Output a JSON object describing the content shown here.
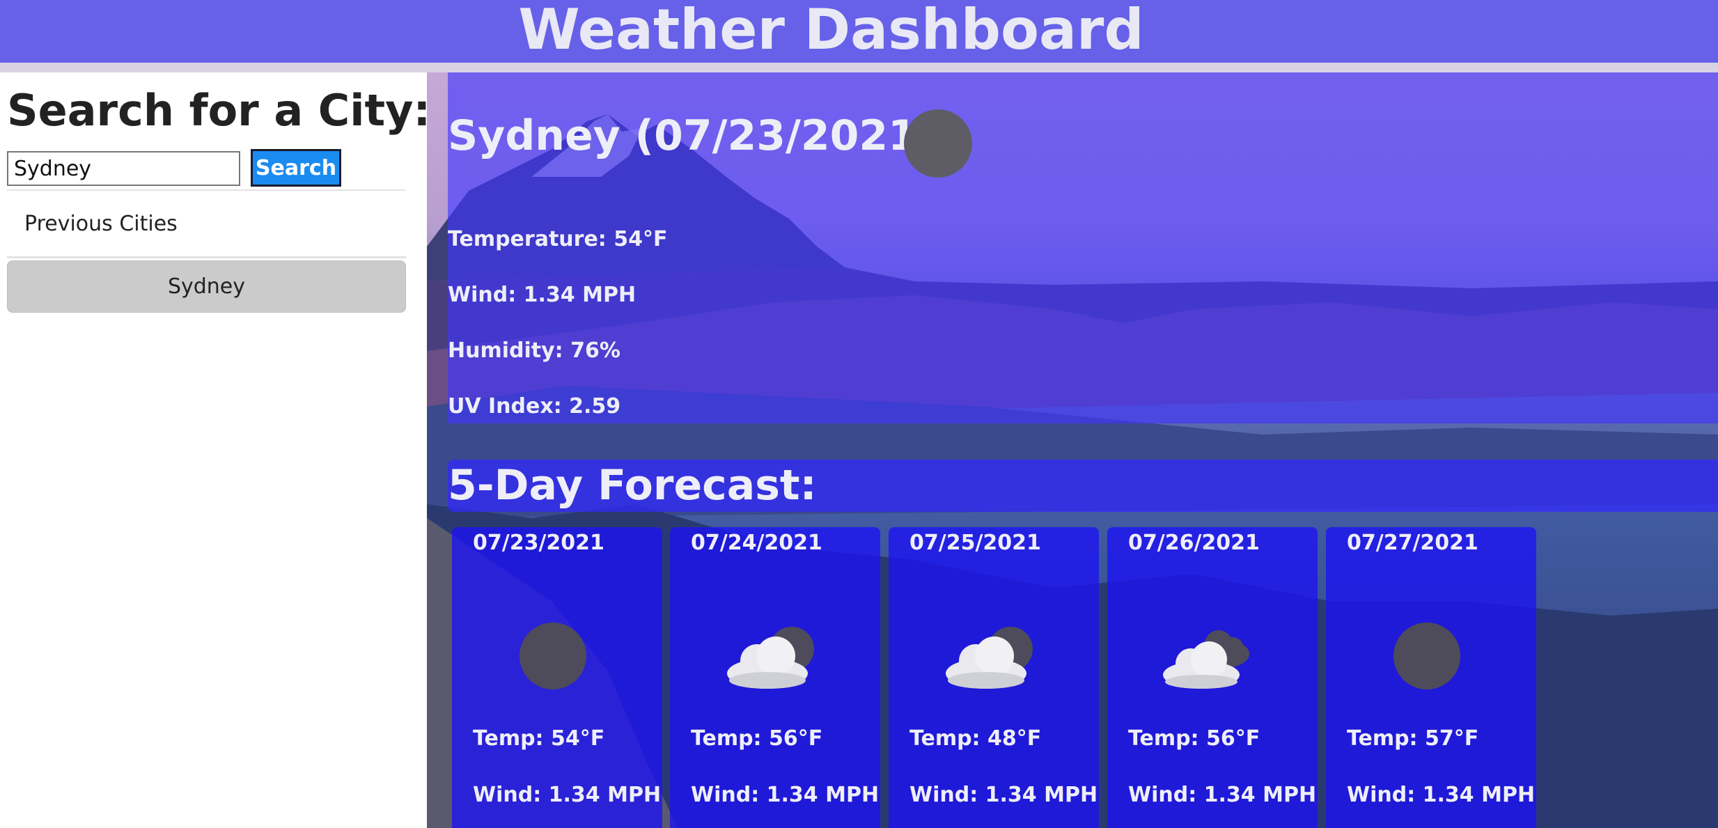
{
  "header": {
    "title": "Weather Dashboard"
  },
  "sidebar": {
    "heading": "Search for a City:",
    "search_value": "Sydney",
    "search_button": "Search",
    "previous_label": "Previous Cities",
    "history": [
      "Sydney"
    ]
  },
  "current": {
    "title": "Sydney (07/23/2021)",
    "icon": "night-clear-icon",
    "temperature": "Temperature: 54°F",
    "wind": "Wind: 1.34 MPH",
    "humidity": "Humidity: 76%",
    "uv": "UV Index: 2.59"
  },
  "forecast": {
    "heading": "5-Day Forecast:",
    "days": [
      {
        "date": "07/23/2021",
        "icon": "night-clear-icon",
        "temp": "Temp: 54°F",
        "wind": "Wind: 1.34 MPH"
      },
      {
        "date": "07/24/2021",
        "icon": "partly-cloudy-night-icon",
        "temp": "Temp: 56°F",
        "wind": "Wind: 1.34 MPH"
      },
      {
        "date": "07/25/2021",
        "icon": "partly-cloudy-night-icon",
        "temp": "Temp: 48°F",
        "wind": "Wind: 1.34 MPH"
      },
      {
        "date": "07/26/2021",
        "icon": "broken-clouds-icon",
        "temp": "Temp: 56°F",
        "wind": "Wind: 1.34 MPH"
      },
      {
        "date": "07/27/2021",
        "icon": "night-clear-icon",
        "temp": "Temp: 57°F",
        "wind": "Wind: 1.34 MPH"
      }
    ]
  },
  "colors": {
    "header_bg": "#6661e8",
    "button_blue": "#1a8cf0",
    "panel_overlay": "#3f34ff"
  }
}
